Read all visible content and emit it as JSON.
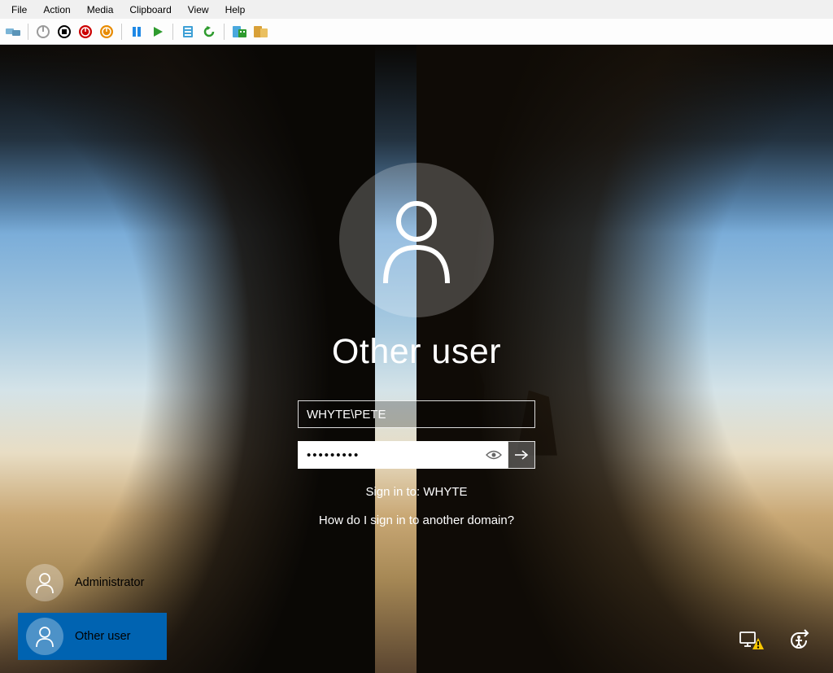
{
  "menubar": {
    "items": [
      "File",
      "Action",
      "Media",
      "Clipboard",
      "View",
      "Help"
    ]
  },
  "toolbar": {
    "icons": [
      {
        "name": "devices-icon",
        "color": "#7ab4d6"
      },
      {
        "name": "power-gray-icon",
        "color": "#9a9a9a"
      },
      {
        "name": "stop-icon",
        "color": "#000000"
      },
      {
        "name": "shutdown-red-icon",
        "color": "#cc0000"
      },
      {
        "name": "shutdown-orange-icon",
        "color": "#e88b00"
      },
      {
        "name": "pause-icon",
        "color": "#1e88e5"
      },
      {
        "name": "play-icon",
        "color": "#2e9b2e"
      },
      {
        "name": "server-icon",
        "color": "#3ea0d6"
      },
      {
        "name": "revert-icon",
        "color": "#2e9b2e"
      },
      {
        "name": "server-add-icon",
        "color": "#4aa8dd"
      },
      {
        "name": "server-yellow-icon",
        "color": "#d8a038"
      }
    ]
  },
  "login": {
    "title": "Other user",
    "username_value": "WHYTE\\PETE",
    "password_masked": "•••••••••",
    "sign_in_to": "Sign in to: WHYTE",
    "domain_help": "How do I sign in to another domain?"
  },
  "user_list": [
    {
      "name": "Administrator",
      "selected": false
    },
    {
      "name": "Other user",
      "selected": true
    }
  ],
  "corner": {
    "network": "network-warning-icon",
    "ease": "ease-of-access-icon"
  }
}
